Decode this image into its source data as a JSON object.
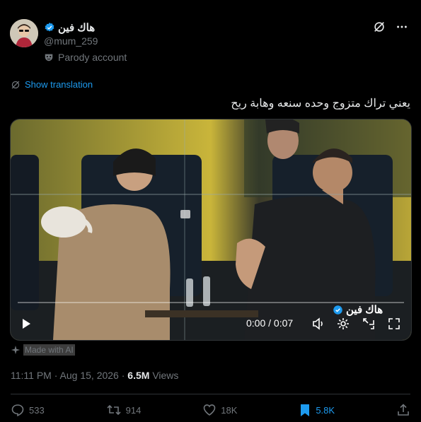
{
  "post": {
    "display_name": "هاك فين",
    "handle": "@mum_259",
    "parody_label": "Parody account",
    "show_translation": "Show translation",
    "text": "يعني تراك متزوج وحده سنعه وهابة ريح",
    "made_with_ai": "Made with AI",
    "time": "11:11 PM",
    "date": "Aug 15, 2026",
    "separator": "·",
    "views_count": "6.5M",
    "views_label": "Views"
  },
  "video": {
    "time_display": "0:00 / 0:07",
    "watermark": "هاك فين"
  },
  "actions": {
    "replies": "533",
    "reposts": "914",
    "likes": "18K",
    "bookmarks": "5.8K"
  },
  "colors": {
    "accent": "#1d9bf0",
    "background": "#000000",
    "muted": "#71767b",
    "text": "#e7e9ea"
  }
}
